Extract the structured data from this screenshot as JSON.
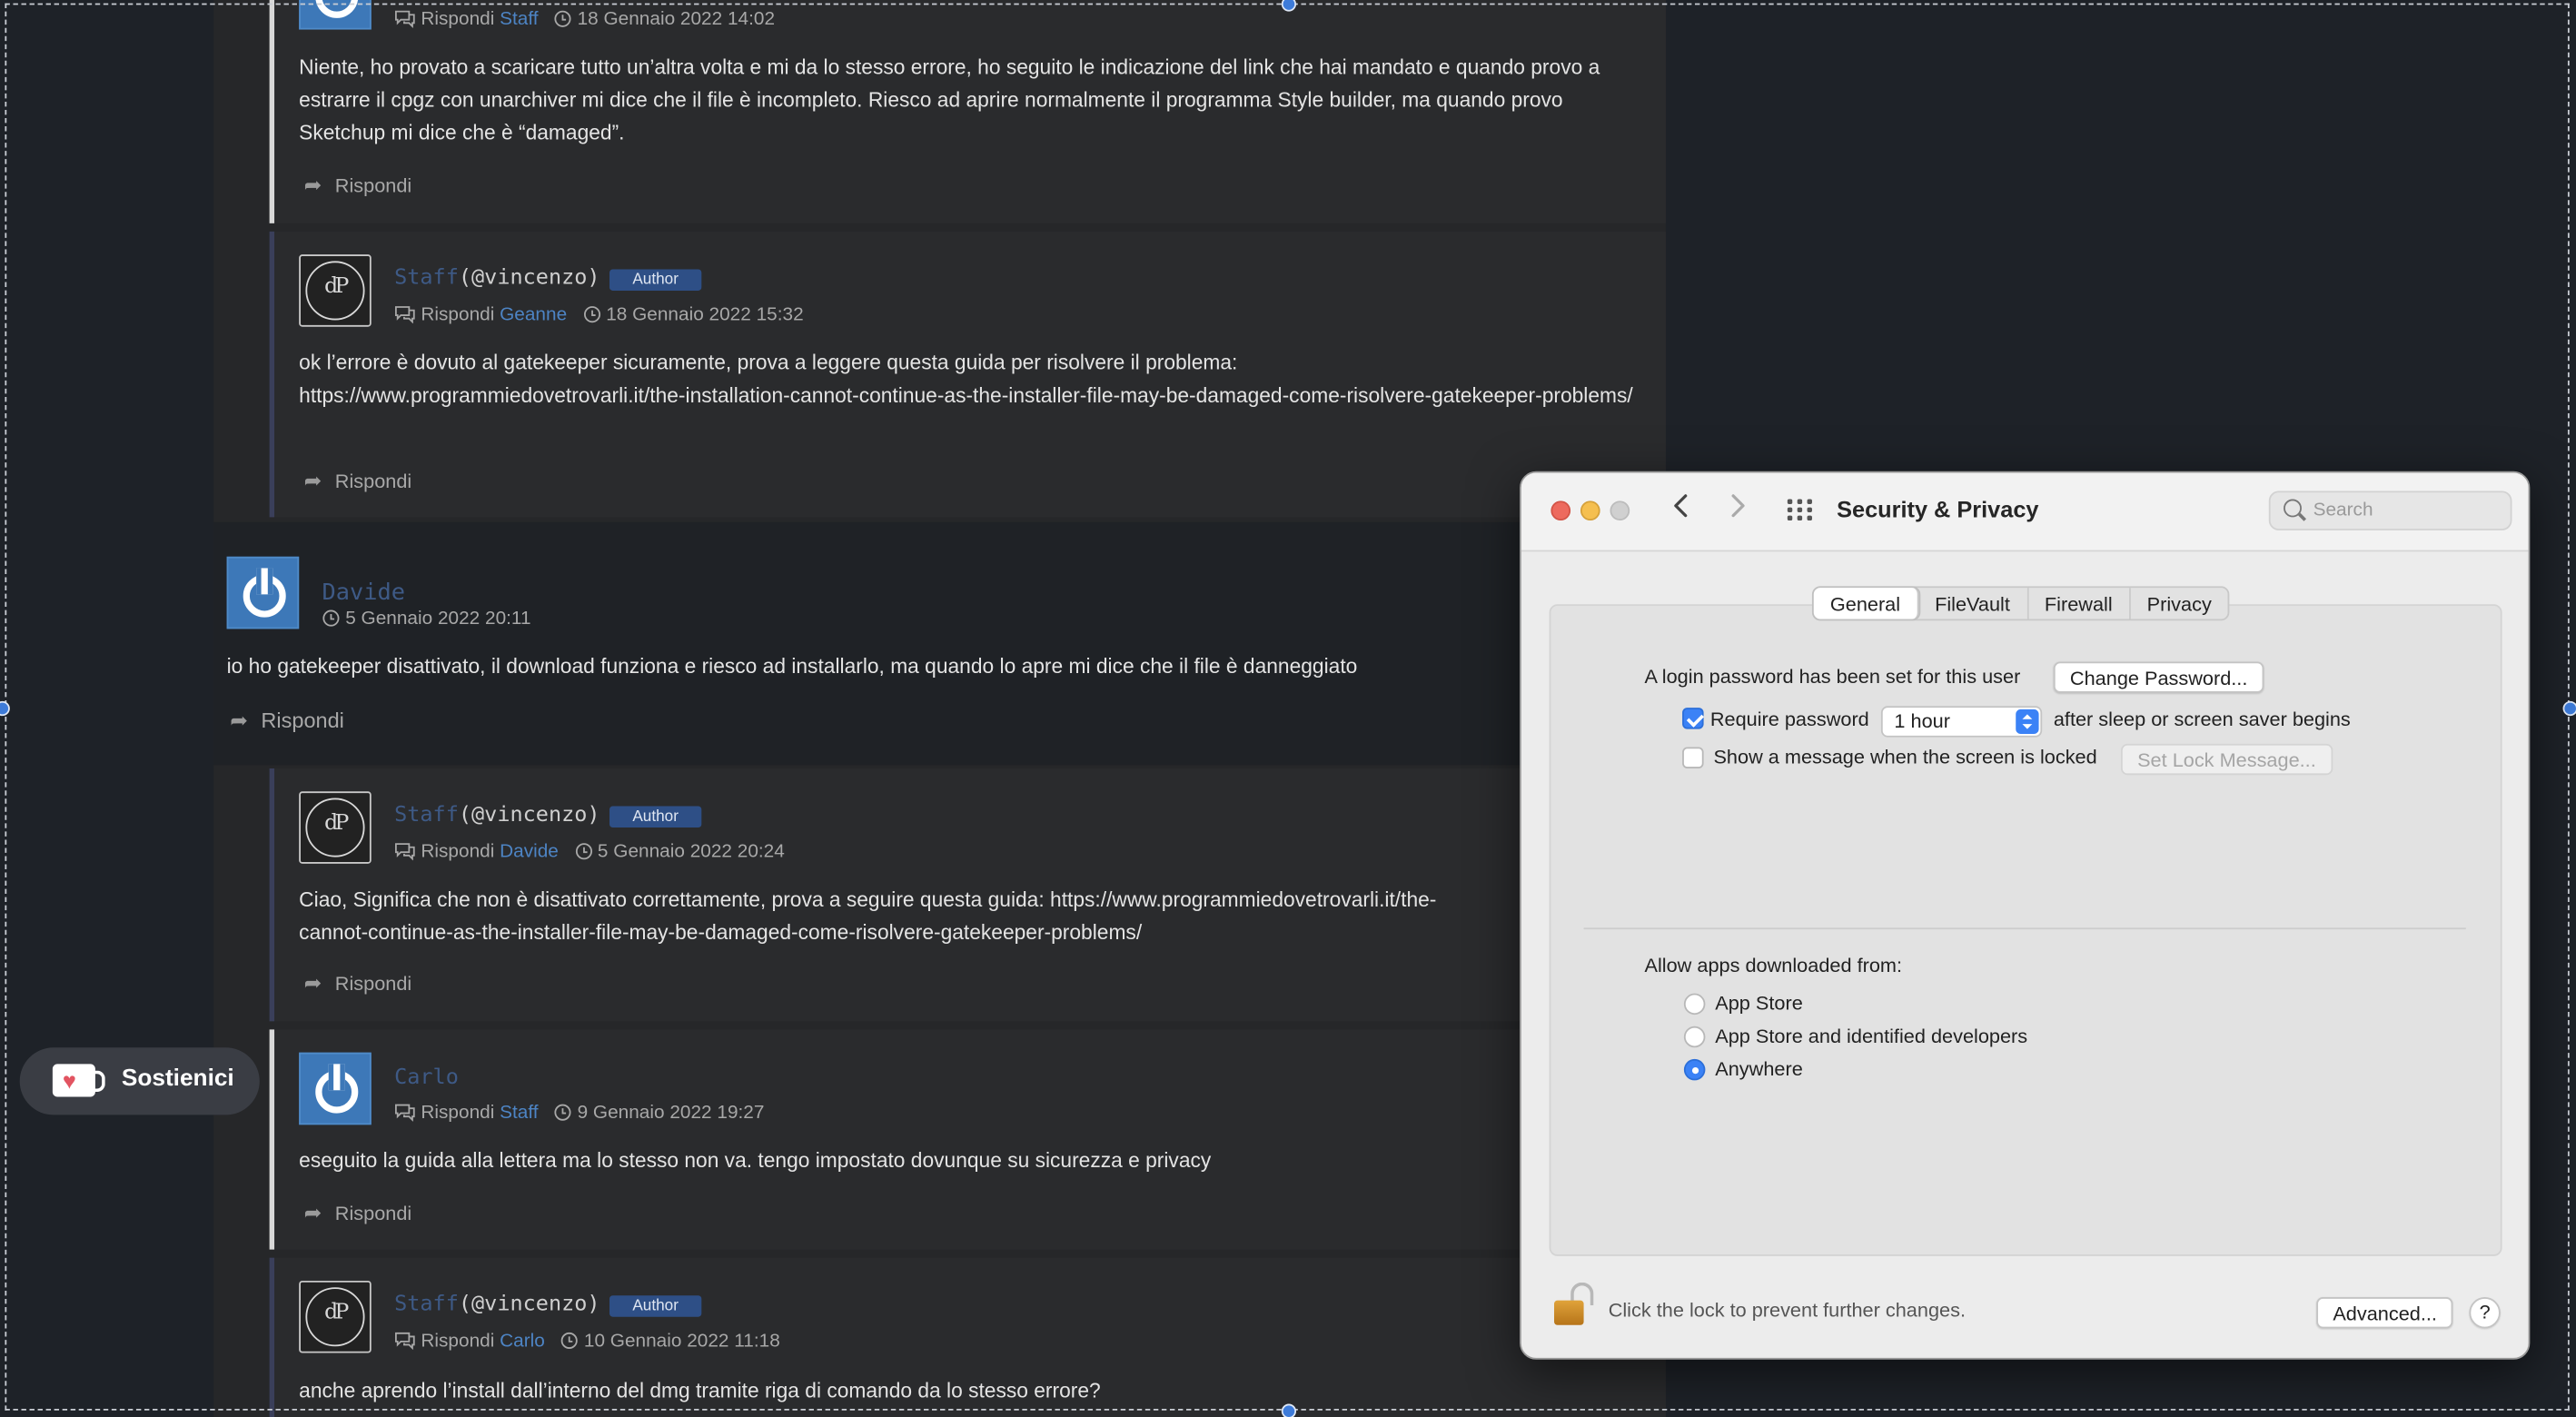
{
  "forum": {
    "post1": {
      "meta_reply": "Rispondi",
      "meta_to": "Staff",
      "meta_date": "18 Gennaio 2022 14:02",
      "body": "Niente, ho provato a scaricare tutto un’altra volta e mi da lo stesso errore, ho seguito le indicazione del link che hai mandato e quando provo a estrarre il cpgz con unarchiver mi dice che il file è incompleto. Riesco ad aprire normalmente il programma Style builder, ma quando provo Sketchup mi dice che è “damaged”.",
      "reply": "Rispondi"
    },
    "post2": {
      "author": "Staff",
      "handle": "(@vincenzo)",
      "badge": "Author",
      "meta_reply": "Rispondi",
      "meta_to": "Geanne",
      "meta_date": "18 Gennaio 2022 15:32",
      "body_text": "ok l’errore è dovuto al gatekeeper sicuramente, prova a leggere questa guida per risolvere il problema:",
      "body_link": "https://www.programmiedovetrovarli.it/the-installation-cannot-continue-as-the-installer-file-may-be-damaged-come-risolvere-gatekeeper-problems/",
      "reply": "Rispondi"
    },
    "post3": {
      "author": "Davide",
      "meta_date": "5 Gennaio 2022 20:11",
      "body": "io ho gatekeeper disattivato, il download funziona e riesco ad installarlo, ma quando lo apre mi dice che il file è danneggiato",
      "reply": "Rispondi"
    },
    "post4": {
      "author": "Staff",
      "handle": "(@vincenzo)",
      "badge": "Author",
      "meta_reply": "Rispondi",
      "meta_to": "Davide",
      "meta_date": "5 Gennaio 2022 20:24",
      "body_text": "Ciao, Significa che non è disattivato correttamente, prova a seguire questa guida:",
      "body_link1": "https://www.programmiedovetrovarli.it/the-",
      "body_link2": "cannot-continue-as-the-installer-file-may-be-damaged-come-risolvere-gatekeeper-problems/",
      "reply": "Rispondi"
    },
    "post5": {
      "author": "Carlo",
      "meta_reply": "Rispondi",
      "meta_to": "Staff",
      "meta_date": "9 Gennaio 2022 19:27",
      "body": "eseguito la guida alla lettera ma lo stesso non va. tengo impostato dovunque su sicurezza e privacy",
      "reply": "Rispondi"
    },
    "post6": {
      "author": "Staff",
      "handle": "(@vincenzo)",
      "badge": "Author",
      "meta_reply": "Rispondi",
      "meta_to": "Carlo",
      "meta_date": "10 Gennaio 2022 11:18",
      "body": "anche aprendo l’install dall’interno del dmg tramite riga di comando da lo stesso errore?"
    },
    "avatar_monogram": "dP"
  },
  "sostienici": {
    "label": "Sostienici",
    "icon": "ko-fi-cup-heart-icon"
  },
  "window": {
    "title": "Security & Privacy",
    "search_placeholder": "Search",
    "tabs": [
      "General",
      "FileVault",
      "Firewall",
      "Privacy"
    ],
    "active_tab": "General",
    "login_text": "A login password has been set for this user",
    "change_password": "Change Password...",
    "require_password_label": "Require password",
    "require_password_checked": true,
    "require_password_value": "1 hour",
    "after_sleep_text": "after sleep or screen saver begins",
    "show_message_label": "Show a message when the screen is locked",
    "show_message_checked": false,
    "set_lock_message": "Set Lock Message...",
    "allow_apps_label": "Allow apps downloaded from:",
    "radio_options": [
      "App Store",
      "App Store and identified developers",
      "Anywhere"
    ],
    "radio_selected": "Anywhere",
    "lock_text": "Click the lock to prevent further changes.",
    "advanced": "Advanced...",
    "help": "?"
  },
  "colors": {
    "accent": "#3b82f6",
    "username": "#3e5a86",
    "link": "#4d84c4",
    "author_badge": "#2e4f86",
    "forum_bg": "#262729"
  }
}
